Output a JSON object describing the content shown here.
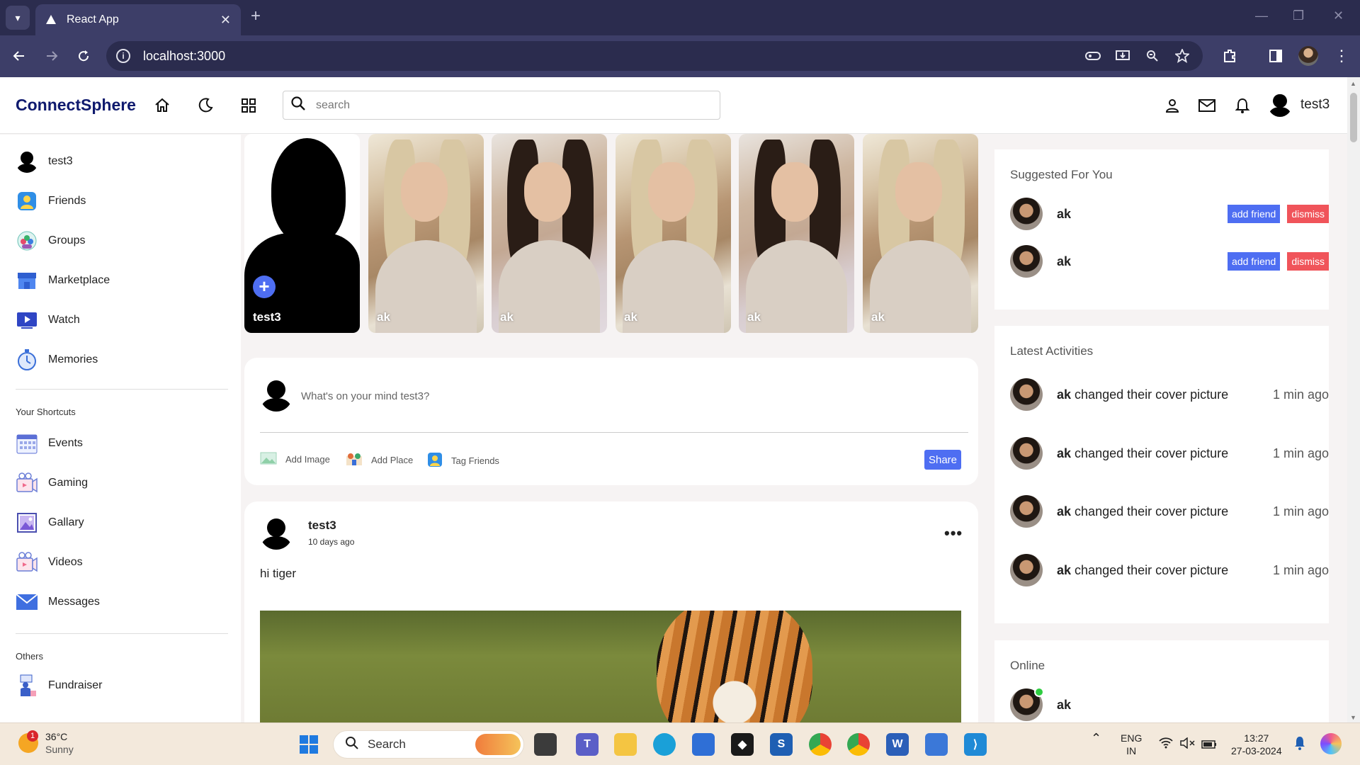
{
  "browser": {
    "tab_title": "React App",
    "url": "localhost:3000"
  },
  "app": {
    "logo": "ConnectSphere",
    "search_placeholder": "search",
    "username": "test3"
  },
  "sidebar": {
    "user": "test3",
    "main_items": [
      {
        "label": "Friends",
        "icon": "friends-icon"
      },
      {
        "label": "Groups",
        "icon": "groups-icon"
      },
      {
        "label": "Marketplace",
        "icon": "marketplace-icon"
      },
      {
        "label": "Watch",
        "icon": "watch-icon"
      },
      {
        "label": "Memories",
        "icon": "memories-icon"
      }
    ],
    "shortcuts_heading": "Your Shortcuts",
    "shortcuts": [
      {
        "label": "Events",
        "icon": "events-icon"
      },
      {
        "label": "Gaming",
        "icon": "gaming-icon"
      },
      {
        "label": "Gallary",
        "icon": "gallery-icon"
      },
      {
        "label": "Videos",
        "icon": "videos-icon"
      },
      {
        "label": "Messages",
        "icon": "messages-icon"
      }
    ],
    "others_heading": "Others",
    "others": [
      {
        "label": "Fundraiser",
        "icon": "fundraiser-icon"
      }
    ]
  },
  "stories": [
    {
      "name": "test3",
      "own": true
    },
    {
      "name": "ak"
    },
    {
      "name": "ak"
    },
    {
      "name": "ak"
    },
    {
      "name": "ak"
    },
    {
      "name": "ak"
    }
  ],
  "composer": {
    "placeholder": "What's on your mind test3?",
    "add_image": "Add Image",
    "add_place": "Add Place",
    "tag_friends": "Tag Friends",
    "share": "Share"
  },
  "post": {
    "author": "test3",
    "time": "10 days ago",
    "text": "hi tiger",
    "menu": "•••"
  },
  "suggested": {
    "title": "Suggested For You",
    "items": [
      {
        "name": "ak",
        "add": "add friend",
        "dismiss": "dismiss"
      },
      {
        "name": "ak",
        "add": "add friend",
        "dismiss": "dismiss"
      }
    ]
  },
  "activities": {
    "title": "Latest Activities",
    "items": [
      {
        "user": "ak",
        "action": "changed their cover picture",
        "time": "1 min ago"
      },
      {
        "user": "ak",
        "action": "changed their cover picture",
        "time": "1 min ago"
      },
      {
        "user": "ak",
        "action": "changed their cover picture",
        "time": "1 min ago"
      },
      {
        "user": "ak",
        "action": "changed their cover picture",
        "time": "1 min ago"
      }
    ]
  },
  "online": {
    "title": "Online",
    "items": [
      {
        "name": "ak"
      }
    ]
  },
  "taskbar": {
    "temperature": "36°C",
    "condition": "Sunny",
    "weather_badge": "1",
    "search": "Search",
    "lang_top": "ENG",
    "lang_bottom": "IN",
    "time": "13:27",
    "date": "27-03-2024"
  },
  "colors": {
    "accent": "#4e6ef2",
    "dismiss": "#f0545a",
    "logo": "#0f1a6e",
    "chrome": "#3d3e68"
  }
}
